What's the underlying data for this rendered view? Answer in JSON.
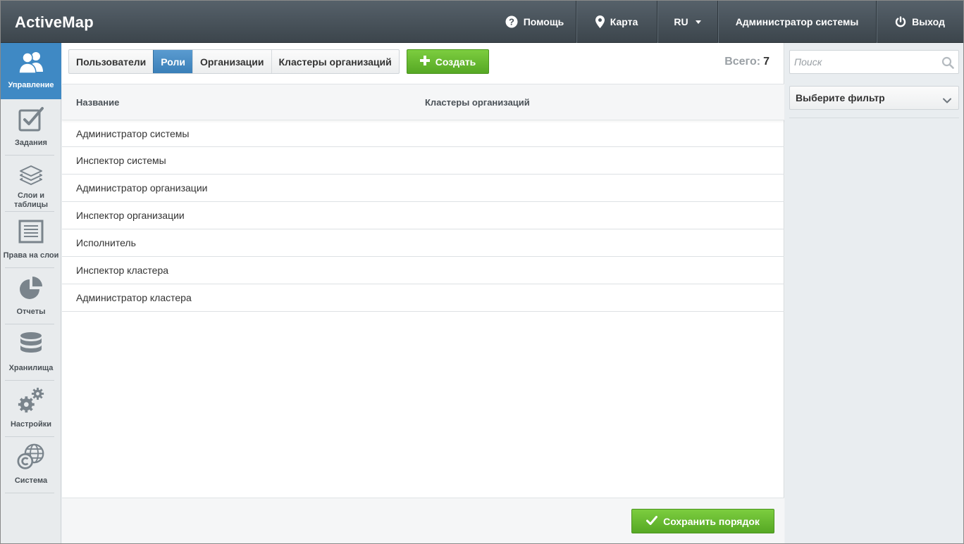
{
  "app": {
    "title": "ActiveMap"
  },
  "topnav": {
    "help": "Помощь",
    "map": "Карта",
    "lang": "RU",
    "user": "Администратор системы",
    "exit": "Выход"
  },
  "sidebar": {
    "items": [
      {
        "label": "Управление",
        "icon": "users-icon",
        "active": true
      },
      {
        "label": "Задания",
        "icon": "checkbox-icon"
      },
      {
        "label": "Слои и таблицы",
        "icon": "layers-icon"
      },
      {
        "label": "Права на слои",
        "icon": "document-list-icon"
      },
      {
        "label": "Отчеты",
        "icon": "pie-chart-icon"
      },
      {
        "label": "Хранилища",
        "icon": "database-icon"
      },
      {
        "label": "Настройки",
        "icon": "gears-icon"
      },
      {
        "label": "Система",
        "icon": "globe-copyright-icon"
      }
    ]
  },
  "main": {
    "tabs": [
      {
        "label": "Пользователи"
      },
      {
        "label": "Роли",
        "active": true
      },
      {
        "label": "Организации"
      },
      {
        "label": "Кластеры организаций"
      }
    ],
    "create_label": "Создать",
    "total_label": "Всего:",
    "total_value": "7",
    "columns": [
      "Название",
      "Кластеры организаций"
    ],
    "rows": [
      "Администратор системы",
      "Инспектор системы",
      "Администратор организации",
      "Инспектор организации",
      "Исполнитель",
      "Инспектор кластера",
      "Администратор кластера"
    ],
    "save_label": "Сохранить порядок"
  },
  "right": {
    "search_placeholder": "Поиск",
    "filter_label": "Выберите фильтр"
  },
  "colors": {
    "accent_blue": "#3f89c4",
    "green": "#5cb22a",
    "topbar": "#48525a"
  }
}
